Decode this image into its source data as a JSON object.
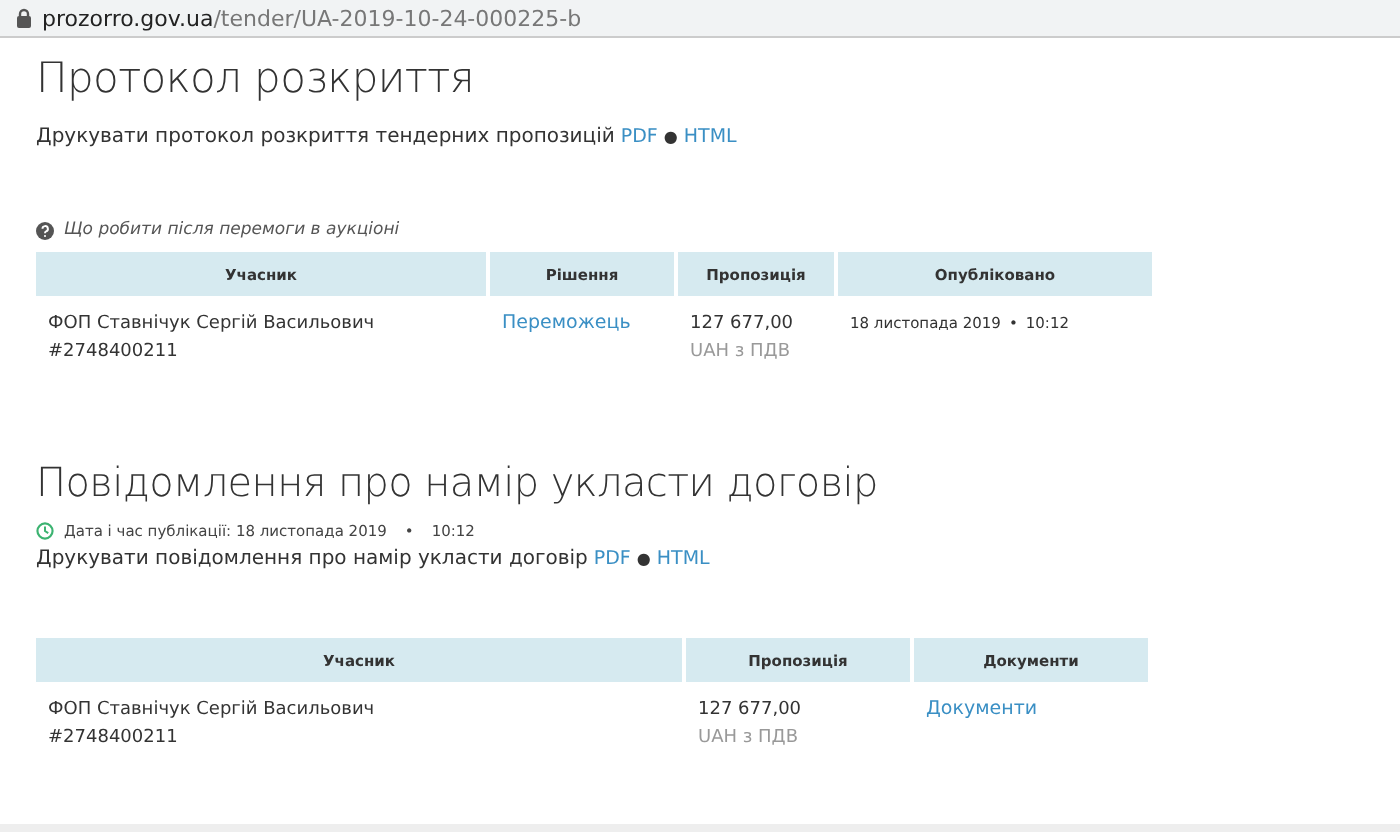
{
  "address_bar": {
    "domain": "prozorro.gov.ua",
    "path": "/tender/UA-2019-10-24-000225-b"
  },
  "sections": [
    {
      "title": "Протокол розкриття",
      "print": {
        "label": "Друкувати протокол розкриття тендерних пропозицій",
        "links": [
          "PDF",
          "●",
          "HTML"
        ]
      },
      "help_link": "Що робити після перемоги в аукціоні",
      "table": {
        "columns": [
          {
            "label": "Учасник"
          },
          {
            "label": "Рішення"
          },
          {
            "label": "Пропозиція"
          },
          {
            "label": "Опубліковано"
          }
        ],
        "rows": [
          [
            {
              "kind": "two_line",
              "lines": [
                "ФОП Ставнічук Сергій Васильович",
                "#2748400211"
              ]
            },
            {
              "kind": "link",
              "text": "Переможець"
            },
            {
              "kind": "amount",
              "lines": [
                "127 677,00",
                "UAH з ПДВ"
              ]
            },
            {
              "kind": "date",
              "parts": [
                "18 листопада 2019",
                "•",
                "10:12"
              ]
            }
          ]
        ]
      }
    },
    {
      "title": "Повідомлення про намір укласти договір",
      "published": {
        "label": "Дата і час публікації: 18 листопада 2019",
        "sep": "•",
        "time": "10:12"
      },
      "print": {
        "label": "Друкувати повідомлення про намір укласти договір",
        "links": [
          "PDF",
          "●",
          "HTML"
        ]
      },
      "table": {
        "columns": [
          {
            "label": "Учасник"
          },
          {
            "label": "Пропозиція"
          },
          {
            "label": "Документи"
          }
        ],
        "rows": [
          [
            {
              "kind": "two_line",
              "lines": [
                "ФОП Ставнічук Сергій Васильович",
                "#2748400211"
              ]
            },
            {
              "kind": "amount",
              "lines": [
                "127 677,00",
                "UAH з ПДВ"
              ]
            },
            {
              "kind": "link",
              "text": "Документи"
            }
          ]
        ]
      }
    }
  ]
}
